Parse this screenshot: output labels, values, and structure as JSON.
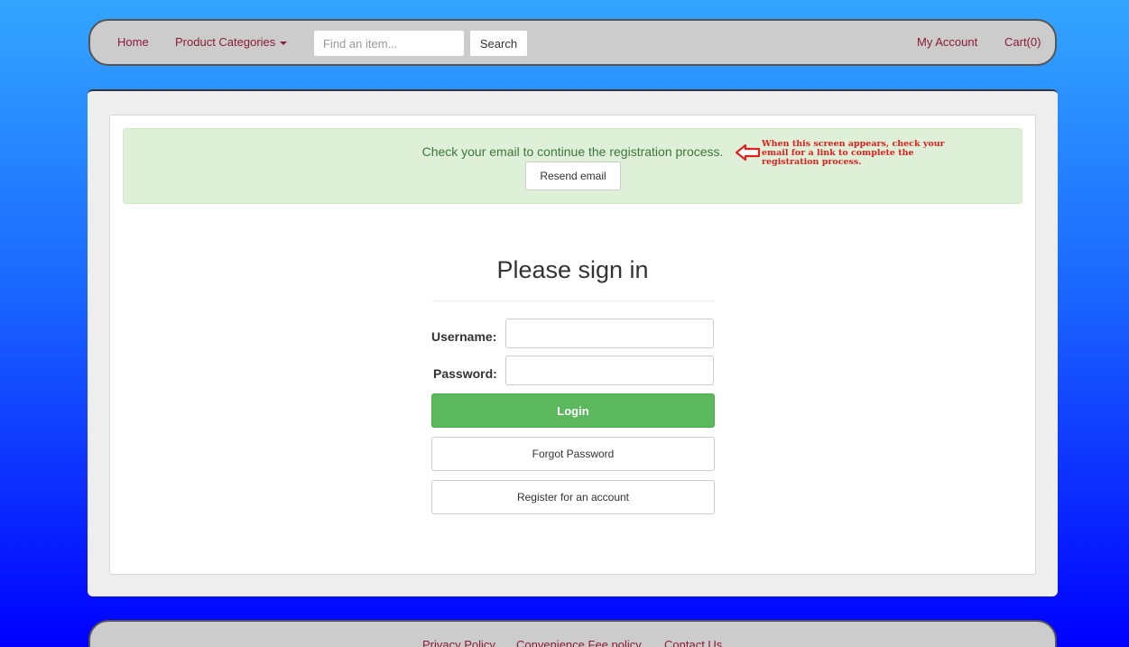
{
  "nav": {
    "home": "Home",
    "product_categories": "Product Categories",
    "search_placeholder": "Find an item...",
    "search_button": "Search",
    "my_account": "My Account",
    "cart": "Cart(0)"
  },
  "alert": {
    "message": "Check your email to continue the registration process.",
    "resend_button": "Resend email"
  },
  "annotation": {
    "text": "When this screen appears, check your email for a link to complete the registration process.",
    "color": "#e0201e",
    "icon": "left-arrow-icon"
  },
  "signin": {
    "title": "Please sign in",
    "username_label": "Username:",
    "password_label": "Password:",
    "login_button": "Login",
    "forgot_button": "Forgot Password",
    "register_button": "Register for an account"
  },
  "footer": {
    "privacy": "Privacy Policy",
    "convenience": "Convenience Fee policy",
    "contact": "Contact Us"
  },
  "colors": {
    "link": "#8b1a3a",
    "success_bg": "#dff0d8",
    "success_text": "#3c763d",
    "login_button": "#5cb85c"
  }
}
